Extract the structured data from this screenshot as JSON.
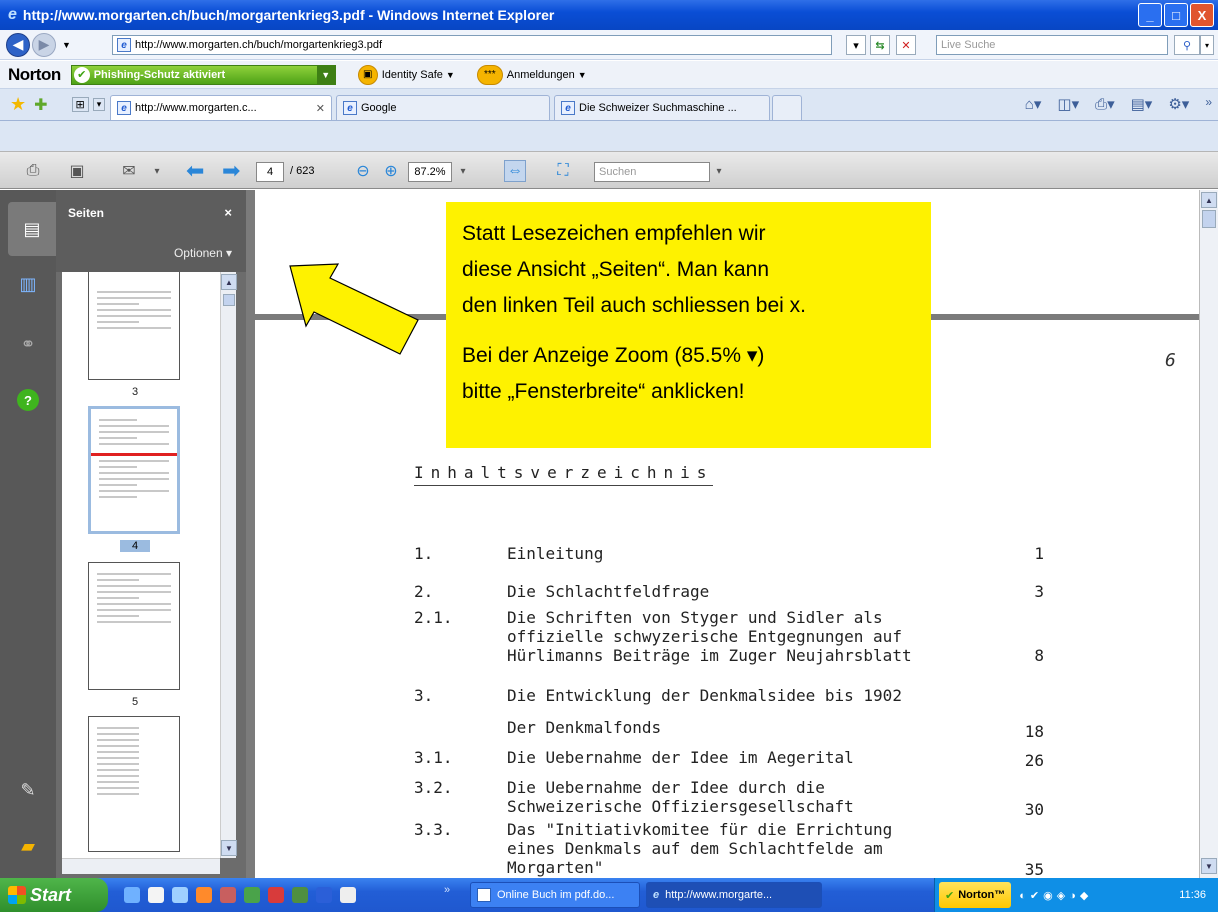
{
  "window": {
    "title": "http://www.morgarten.ch/buch/morgartenkrieg3.pdf - Windows Internet Explorer",
    "minimize": "_",
    "maximize": "□",
    "close": "X"
  },
  "addressbar": {
    "url": "http://www.morgarten.ch/buch/morgartenkrieg3.pdf",
    "search_placeholder": "Live Suche"
  },
  "norton": {
    "logo": "Norton",
    "phishing": "Phishing-Schutz aktiviert",
    "identity_safe": "Identity Safe",
    "logins": "Anmeldungen"
  },
  "tabs": [
    {
      "label": "http://www.morgarten.c...",
      "active": true
    },
    {
      "label": "Google",
      "active": false
    },
    {
      "label": "Die Schweizer Suchmaschine ...",
      "active": false
    }
  ],
  "acrobat": {
    "page_current": "4",
    "page_total": "/ 623",
    "zoom": "87.2%",
    "search_placeholder": "Suchen"
  },
  "pages_panel": {
    "title": "Seiten",
    "close": "×",
    "options": "Optionen ▾",
    "thumbnails": [
      {
        "label": "3",
        "selected": false
      },
      {
        "label": "4",
        "selected": true
      },
      {
        "label": "5",
        "selected": false
      },
      {
        "label": "",
        "selected": false
      }
    ]
  },
  "callout": {
    "line1": "Statt Lesezeichen empfehlen wir",
    "line2": "diese Ansicht „Seiten“. Man kann",
    "line3": "den linken Teil auch schliessen bei x.",
    "line4": "Bei der Anzeige Zoom (85.5% ▾)",
    "line5": "bitte „Fensterbreite“ anklicken!"
  },
  "document": {
    "corner_mark": "6",
    "toc_title": "Inhaltsverzeichnis",
    "entries": [
      {
        "num": "1.",
        "text": "Einleitung",
        "page": "1"
      },
      {
        "num": "2.",
        "text": "Die Schlachtfeldfrage",
        "page": "3"
      },
      {
        "num": "2.1.",
        "text": "Die Schriften von Styger und Sidler als\noffizielle schwyzerische Entgegnungen auf\nHürlimanns Beiträge im Zuger Neujahrsblatt",
        "page": "8"
      },
      {
        "num": "3.",
        "text": "Die Entwicklung der Denkmalsidee bis 1902",
        "page": ""
      },
      {
        "num": "",
        "text": "Der Denkmalfonds",
        "page": "18"
      },
      {
        "num": "3.1.",
        "text": "Die Uebernahme der Idee im Aegerital",
        "page": "26"
      },
      {
        "num": "3.2.",
        "text": "Die Uebernahme der Idee durch die\nSchweizerische Offiziersgesellschaft",
        "page": "30"
      },
      {
        "num": "3.3.",
        "text": "Das \"Initiativkomitee für die Errichtung\neines Denkmals auf dem Schlachtfelde am\nMorgarten\"",
        "page": "35"
      }
    ]
  },
  "taskbar": {
    "start": "Start",
    "items": [
      "Online Buch im pdf.do...",
      "http://www.morgarte..."
    ],
    "norton": "Norton™",
    "clock": "11:36"
  }
}
